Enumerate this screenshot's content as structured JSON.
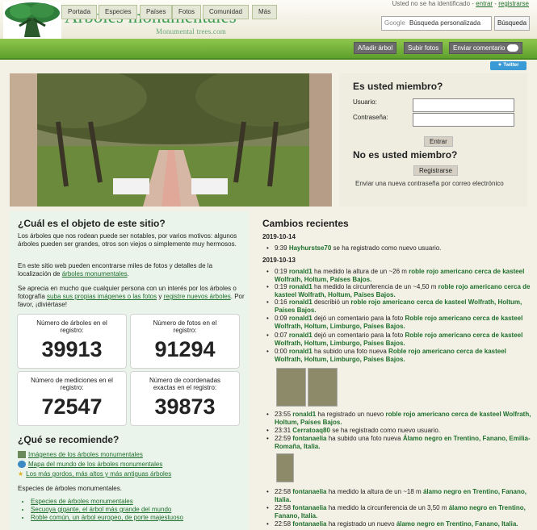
{
  "header": {
    "title": "Árboles monumentales",
    "subtitle": "Monumental trees.com",
    "user_status": "Usted no se ha identificado",
    "login_link": "entrar",
    "register_link": "registrarse",
    "search_google": "Google",
    "search_placeholder": "Búsqueda personalizada",
    "search_button": "Búsqueda"
  },
  "nav": {
    "tabs": [
      "Portada",
      "Especies",
      "Países",
      "Fotos",
      "Comunidad",
      "Más"
    ],
    "actions": [
      "Añadir árbol",
      "Subir fotos",
      "Enviar comentario"
    ],
    "twitter": "Twitter"
  },
  "login": {
    "title": "Es usted miembro?",
    "user_label": "Usuario:",
    "pass_label": "Contraseña:",
    "enter_button": "Entrar",
    "not_member": "No es usted miembro?",
    "register_button": "Registrarse",
    "send_password": "Enviar una nueva contraseña por correo electrónico"
  },
  "about": {
    "heading": "¿Cuál es el objeto de este sitio?",
    "p1": "Los árboles que nos rodean puede ser notables, por varios motivos: algunos árboles pueden ser grandes, otros son viejos o simplemente muy hermosos.",
    "p2_pre": "En este sitio web pueden encontrarse miles de fotos y detalles de la localización de",
    "p2_link": "árboles monumentales",
    "p2_post": ".",
    "p3_pre": "Se aprecia en mucho que cualquier persona con un interés por los árboles o fotografía",
    "p3_link1": "suba sus propias imágenes o las fotos",
    "p3_mid": "y",
    "p3_link2": "registre nuevos árboles",
    "p3_post": ". Por favor, ¡diviértase!"
  },
  "stats": [
    {
      "label": "Número de árboles en el registro:",
      "value": "39913"
    },
    {
      "label": "Número de fotos en el registro:",
      "value": "91294"
    },
    {
      "label": "Número de mediciones en el registro:",
      "value": "72547"
    },
    {
      "label": "Número de coordenadas exactas en el registro:",
      "value": "39873"
    }
  ],
  "recommend": {
    "heading": "¿Qué se recomiende?",
    "items": [
      "Imágenes de los árboles monumentales",
      "Mapa del mundo de los árboles monumentales",
      "Los más gordos, más altos y más antiguas árboles"
    ],
    "species_heading": "Especies de árboles monumentales.",
    "species": [
      "Especies de árboles monumentales",
      "Secuoya gigante, el árbol más grande del mundo",
      "Roble común, un árbol europeo, de porte majestuoso"
    ]
  },
  "changes": {
    "heading": "Cambios recientes",
    "date1": "2019-10-14",
    "date2": "2019-10-13",
    "events": [
      {
        "time": "9:39",
        "user": "Hayhurstse70",
        "text": "se ha registrado como nuevo usuario."
      },
      {
        "time": "0:19",
        "user": "ronald1",
        "text": "ha medido la altura de un ~26 m",
        "tree": "roble rojo americano",
        "place": "cerca de kasteel Wolfrath, Holtum, Países Bajos."
      },
      {
        "time": "0:19",
        "user": "ronald1",
        "text": "ha medido la circunferencia de un ~4,50 m",
        "tree": "roble rojo americano",
        "place": "cerca de kasteel Wolfrath, Holtum, Países Bajos."
      },
      {
        "time": "0:16",
        "user": "ronald1",
        "text": "describió un",
        "tree": "roble rojo americano",
        "place": "cerca de kasteel Wolfrath, Holtum, Países Bajos."
      },
      {
        "time": "0:09",
        "user": "ronald1",
        "text": "dejó un comentario para la foto",
        "tree": "Roble rojo americano",
        "place": "cerca de kasteel Wolfrath, Holtum, Limburgo, Países Bajos."
      },
      {
        "time": "0:07",
        "user": "ronald1",
        "text": "dejó un comentario para la foto",
        "tree": "Roble rojo americano",
        "place": "cerca de kasteel Wolfrath, Holtum, Limburgo, Países Bajos."
      },
      {
        "time": "0:00",
        "user": "ronald1",
        "text": "ha subido una foto nueva",
        "tree": "Roble rojo americano",
        "place": "cerca de kasteel Wolfrath, Holtum, Limburgo, Países Bajos."
      },
      {
        "time": "23:55",
        "user": "ronald1",
        "text": "ha registrado un nuevo",
        "tree": "roble rojo americano",
        "place": "cerca de kasteel Wolfrath, Holtum, Países Bajos."
      },
      {
        "time": "23:31",
        "user": "Cerratoaq80",
        "text": "se ha registrado como nuevo usuario."
      },
      {
        "time": "22:59",
        "user": "fontanaelia",
        "text": "ha subido una foto nueva",
        "tree": "Álamo negro en Trentino,",
        "place": "Fanano, Emilia-Romaña, Italia."
      },
      {
        "time": "22:58",
        "user": "fontanaelia",
        "text": "ha medido la altura de un ~18 m",
        "tree": "álamo negro",
        "place": "en Trentino, Fanano, Italia."
      },
      {
        "time": "22:58",
        "user": "fontanaelia",
        "text": "ha medido la circunferencia de un 3,50 m",
        "tree": "álamo negro",
        "place": "en Trentino, Fanano, Italia."
      },
      {
        "time": "22:58",
        "user": "fontanaelia",
        "text": "ha registrado un nuevo",
        "tree": "álamo negro",
        "place": "en Trentino, Fanano, Italia."
      }
    ]
  }
}
